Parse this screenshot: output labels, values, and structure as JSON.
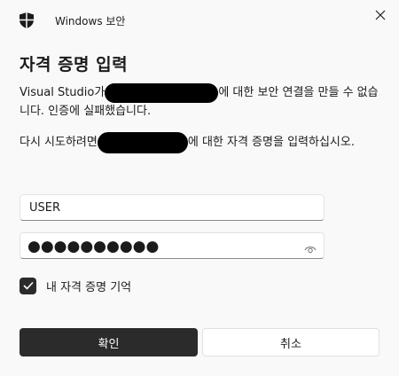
{
  "window": {
    "title": "Windows 보안",
    "icon": "shield-icon",
    "close_icon": "close-icon"
  },
  "dialog": {
    "heading": "자격 증명 입력",
    "message1_prefix": "Visual Studio가",
    "message1_suffix": "에 대한 보안 연결을 만들 수 없습니다. 인증에 실패했습니다.",
    "message2_prefix": "다시 시도하려면",
    "message2_suffix": "에 대한 자격 증명을 입력하십시오."
  },
  "form": {
    "username_value": "USER",
    "password_mask": "●●●●●●●●●●",
    "reveal_icon": "eye-icon",
    "remember_label": "내 자격 증명 기억",
    "remember_checked": true
  },
  "buttons": {
    "ok_label": "확인",
    "cancel_label": "취소"
  },
  "colors": {
    "primary_button": "#2b2b2b",
    "background": "#f9f9f9"
  }
}
